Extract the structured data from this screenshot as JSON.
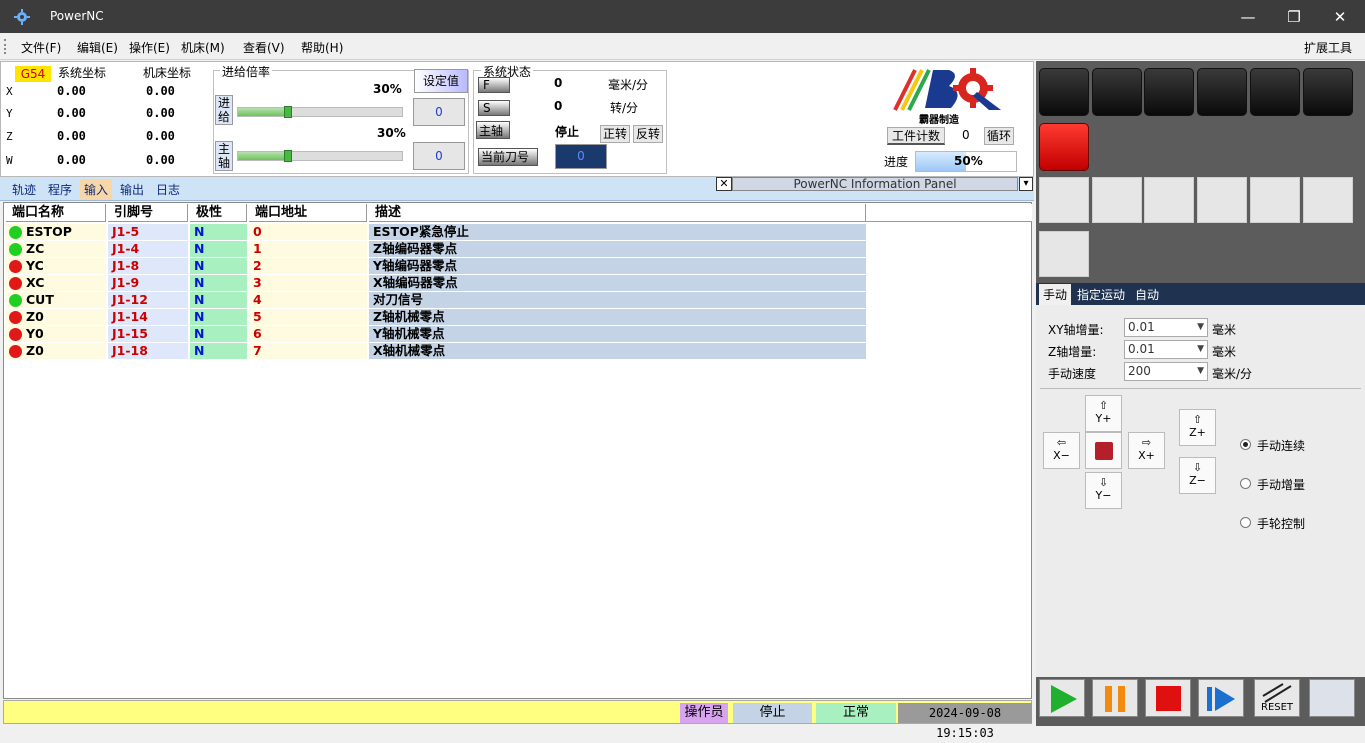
{
  "window": {
    "title": "PowerNC",
    "min": "—",
    "max": "❐",
    "close": "✕"
  },
  "menu": {
    "items": [
      "文件(F)",
      "编辑(E)",
      "操作(E)",
      "机床(M)",
      "查看(V)",
      "帮助(H)"
    ],
    "right": "扩展工具"
  },
  "coords": {
    "wcs": "G54",
    "sys_label": "系统坐标",
    "mach_label": "机床坐标",
    "axes": [
      {
        "axis": "X",
        "sys": "0.00",
        "mach": "0.00"
      },
      {
        "axis": "Y",
        "sys": "0.00",
        "mach": "0.00"
      },
      {
        "axis": "Z",
        "sys": "0.00",
        "mach": "0.00"
      },
      {
        "axis": "W",
        "sys": "0.00",
        "mach": "0.00"
      }
    ]
  },
  "override": {
    "title": "进给倍率",
    "set_label": "设定值",
    "feed_label": "进给",
    "feed_pct": "30%",
    "feed_value": "0",
    "feed_fraction": 0.3,
    "spindle_label": "主轴",
    "spindle_pct": "30%",
    "spindle_value": "0",
    "spindle_fraction": 0.3
  },
  "sysstatus": {
    "title": "系统状态",
    "f_label": "F",
    "f_value": "0",
    "f_unit": "毫米/分",
    "s_label": "S",
    "s_value": "0",
    "s_unit": "转/分",
    "spindle_label": "主轴",
    "spindle_state": "停止",
    "fwd": "正转",
    "rev": "反转",
    "tool_label": "当前刀号",
    "tool_value": "0"
  },
  "logo": {
    "caption": "霸器制造"
  },
  "counters": {
    "work_label": "工件计数",
    "work_value": "0",
    "cycle": "循环",
    "progress_label": "进度",
    "progress_pct": "50%",
    "progress_fraction": 0.5
  },
  "tabs": [
    "轨迹",
    "程序",
    "输入",
    "输出",
    "日志"
  ],
  "active_tab": 2,
  "info_panel": {
    "close": "✕",
    "title": "PowerNC Information Panel",
    "dropdown": "▾"
  },
  "table": {
    "columns": [
      "端口名称",
      "引脚号",
      "极性",
      "端口地址",
      "描述"
    ],
    "rows": [
      {
        "status": "green",
        "name": "ESTOP",
        "pin": "J1-5",
        "polarity": "N",
        "addr": "0",
        "desc": "ESTOP紧急停止"
      },
      {
        "status": "green",
        "name": "ZC",
        "pin": "J1-4",
        "polarity": "N",
        "addr": "1",
        "desc": "Z轴编码器零点"
      },
      {
        "status": "red",
        "name": "YC",
        "pin": "J1-8",
        "polarity": "N",
        "addr": "2",
        "desc": "Y轴编码器零点"
      },
      {
        "status": "red",
        "name": "XC",
        "pin": "J1-9",
        "polarity": "N",
        "addr": "3",
        "desc": "X轴编码器零点"
      },
      {
        "status": "green",
        "name": "CUT",
        "pin": "J1-12",
        "polarity": "N",
        "addr": "4",
        "desc": "对刀信号"
      },
      {
        "status": "red",
        "name": "Z0",
        "pin": "J1-14",
        "polarity": "N",
        "addr": "5",
        "desc": "Z轴机械零点"
      },
      {
        "status": "red",
        "name": "Y0",
        "pin": "J1-15",
        "polarity": "N",
        "addr": "6",
        "desc": "Y轴机械零点"
      },
      {
        "status": "red",
        "name": "Z0",
        "pin": "J1-18",
        "polarity": "N",
        "addr": "7",
        "desc": "X轴机械零点"
      }
    ]
  },
  "status": {
    "operator": "操作员",
    "state": "停止",
    "health": "正常",
    "datetime": "2024-09-08 19:15:03"
  },
  "manual": {
    "tabs": [
      "手动",
      "指定运动",
      "自动"
    ],
    "xy_inc_label": "XY轴增量:",
    "xy_inc_value": "0.01",
    "xy_unit": "毫米",
    "z_inc_label": "Z轴增量:",
    "z_inc_value": "0.01",
    "z_unit": "毫米",
    "speed_label": "手动速度",
    "speed_value": "200",
    "speed_unit": "毫米/分",
    "jog": {
      "y_plus": "Y+",
      "y_minus": "Y−",
      "x_plus": "X+",
      "x_minus": "X−",
      "z_plus": "Z+",
      "z_minus": "Z−"
    },
    "modes": [
      "手动连续",
      "手动增量",
      "手轮控制"
    ],
    "selected_mode": 0
  },
  "controls": {
    "reset": "RESET"
  },
  "colors": {
    "accent_green": "#20d020",
    "accent_red": "#e01818",
    "titlebar": "#3c3c3c"
  }
}
